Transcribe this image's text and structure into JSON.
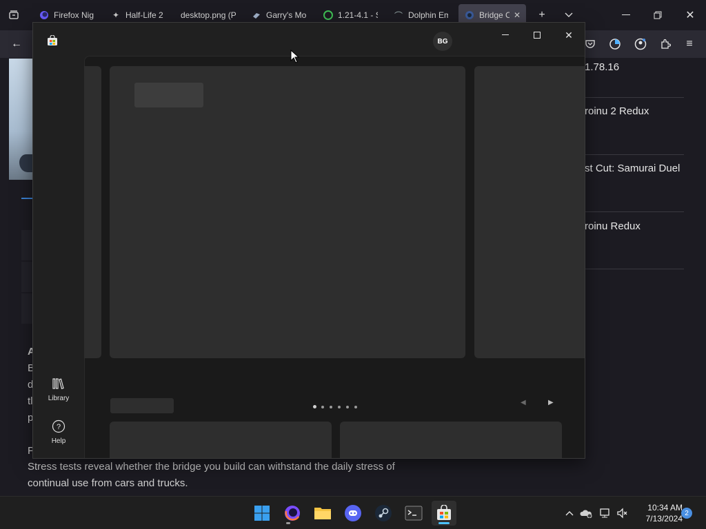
{
  "browser": {
    "tabs": [
      {
        "title": "Firefox Nig",
        "icon": "firefox-icon"
      },
      {
        "title": "Half-Life 2",
        "icon": "halflife-icon"
      },
      {
        "title": "desktop.png (P",
        "icon": "image-icon"
      },
      {
        "title": "Garry's Mo",
        "icon": "steam-icon"
      },
      {
        "title": "1.21-4.1 - S",
        "icon": "green-logo-icon"
      },
      {
        "title": "Dolphin Em",
        "icon": "dolphin-icon"
      },
      {
        "title": "Bridge C",
        "icon": "steam-icon",
        "active": true
      }
    ]
  },
  "page": {
    "version_text": "1.78.16",
    "list": [
      "roinu 2 Redux",
      "st Cut: Samurai Duel",
      "roinu Redux"
    ],
    "para_letters": [
      "A",
      "B",
      "d",
      "tl",
      "p"
    ],
    "para_p_letter": "P",
    "paragraph_lines": [
      "Stress tests reveal whether the bridge you build can withstand the daily stress of",
      "continual use from cars and trucks."
    ]
  },
  "store": {
    "avatar_initials": "BG",
    "nav": [
      {
        "label": "Library",
        "icon": "library-icon"
      },
      {
        "label": "Help",
        "icon": "help-icon"
      }
    ],
    "carousel_page_count": 6,
    "carousel_active_index": 0
  },
  "taskbar": {
    "apps": [
      "start-icon",
      "firefox-icon",
      "file-explorer-icon",
      "discord-icon",
      "steam-icon",
      "terminal-icon",
      "store-icon"
    ],
    "time": "10:34 AM",
    "date": "7/13/2024",
    "notification_count": "2"
  },
  "colors": {
    "accent": "#3b83d6",
    "window_bg": "#202020",
    "placeholder": "#2e2e2e"
  }
}
